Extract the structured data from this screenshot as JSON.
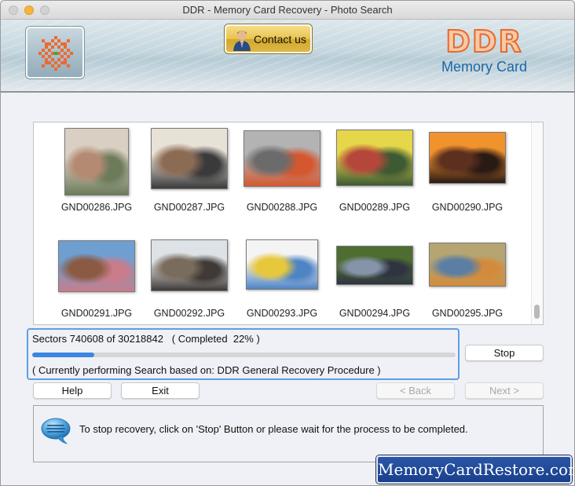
{
  "window": {
    "title": "DDR - Memory Card Recovery - Photo Search"
  },
  "header": {
    "contact_label": "Contact us",
    "brand_name": "DDR",
    "brand_subtitle": "Memory Card",
    "logo_icon": "checker-star-logo-icon",
    "contact_icon": "person-icon"
  },
  "gallery": {
    "files": [
      {
        "name": "GND00286.JPG",
        "palette": [
          "#d9cfc3",
          "#b48a73",
          "#6c7b5a"
        ]
      },
      {
        "name": "GND00287.JPG",
        "palette": [
          "#e8e2d6",
          "#8c6b55",
          "#3a3a3a"
        ]
      },
      {
        "name": "GND00288.JPG",
        "palette": [
          "#b3b3b3",
          "#6b6b6b",
          "#d4572f"
        ]
      },
      {
        "name": "GND00289.JPG",
        "palette": [
          "#e6d64a",
          "#b5473a",
          "#3e5a33"
        ]
      },
      {
        "name": "GND00290.JPG",
        "palette": [
          "#f0932d",
          "#5c2f1e",
          "#2a1a14"
        ]
      },
      {
        "name": "GND00291.JPG",
        "palette": [
          "#6f9fd0",
          "#8a5a43",
          "#c97c8a"
        ]
      },
      {
        "name": "GND00292.JPG",
        "palette": [
          "#dde2e6",
          "#7a6c5c",
          "#3f3a36"
        ]
      },
      {
        "name": "GND00293.JPG",
        "palette": [
          "#f4f4f4",
          "#e7c83c",
          "#4f84c4"
        ]
      },
      {
        "name": "GND00294.JPG",
        "palette": [
          "#4d6e30",
          "#8594a8",
          "#2f3440"
        ]
      },
      {
        "name": "GND00295.JPG",
        "palette": [
          "#b6a572",
          "#5d7ea3",
          "#d38b3b"
        ]
      }
    ]
  },
  "progress": {
    "sectors_text": "Sectors 740608 of 30218842   ( Completed  22% )",
    "sectors_done": 740608,
    "sectors_total": 30218842,
    "percent_complete": 22,
    "fill_fraction": 0.146,
    "status_text": "( Currently performing Search based on: DDR General Recovery Procedure )"
  },
  "buttons": {
    "stop": "Stop",
    "help": "Help",
    "exit": "Exit",
    "back": "< Back",
    "next": "Next >"
  },
  "info": {
    "message": "To stop recovery, click on 'Stop' Button or please wait for the process to be completed.",
    "icon": "speech-bubble-icon"
  },
  "watermark": {
    "text": "MemoryCardRestore.com"
  },
  "colors": {
    "accent_blue": "#3a86e0",
    "brand_orange": "#e86a2c",
    "brand_blue": "#1a67a8",
    "watermark_bg": "#1f4a99"
  }
}
